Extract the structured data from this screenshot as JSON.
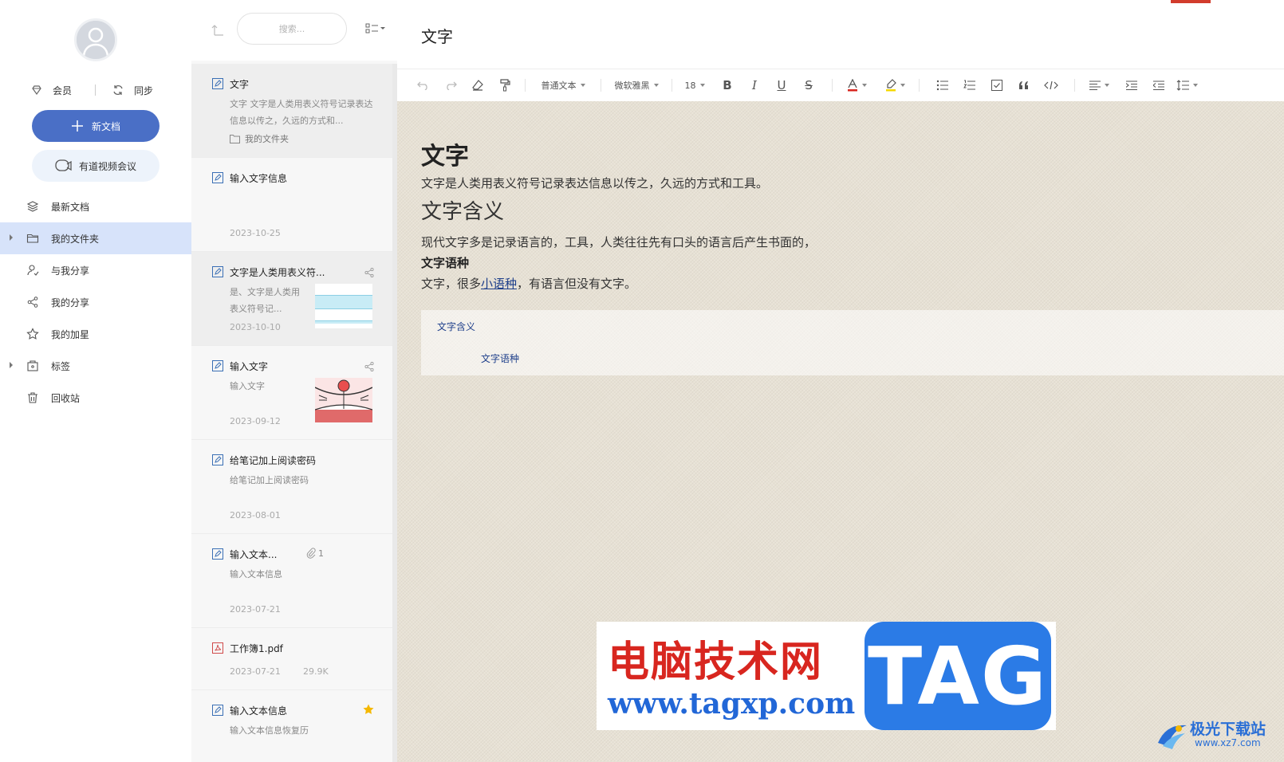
{
  "sidebar": {
    "vip_label": "会员",
    "sync_label": "同步",
    "new_doc_label": "新文档",
    "meeting_label": "有道视频会议",
    "nav": [
      {
        "label": "最新文档",
        "icon": "layers-icon",
        "active": false
      },
      {
        "label": "我的文件夹",
        "icon": "folder-icon",
        "active": true
      },
      {
        "label": "与我分享",
        "icon": "shared-with-me-icon",
        "active": false
      },
      {
        "label": "我的分享",
        "icon": "share-icon",
        "active": false
      },
      {
        "label": "我的加星",
        "icon": "star-icon",
        "active": false
      },
      {
        "label": "标签",
        "icon": "tag-icon",
        "active": false
      },
      {
        "label": "回收站",
        "icon": "trash-icon",
        "active": false
      }
    ]
  },
  "list": {
    "search_placeholder": "搜索...",
    "notes": [
      {
        "title": "文字",
        "summary": "文字 文字是人类用表义符号记录表达信息以传之，久远的方式和...",
        "folder": "我的文件夹",
        "date": ""
      },
      {
        "title": "输入文字信息",
        "summary": "",
        "date": "2023-10-25"
      },
      {
        "title": "文字是人类用表义符...",
        "summary": "是、文字是人类用表义符号记...",
        "date": "2023-10-10"
      },
      {
        "title": "输入文字",
        "summary": "输入文字",
        "date": "2023-09-12"
      },
      {
        "title": "给笔记加上阅读密码",
        "summary": "给笔记加上阅读密码",
        "date": "2023-08-01"
      },
      {
        "title": "输入文本...",
        "summary": "输入文本信息",
        "date": "2023-07-21",
        "attachments": "1"
      },
      {
        "title": "工作簿1.pdf",
        "summary": "",
        "date": "2023-07-21",
        "size": "29.9K"
      },
      {
        "title": "输入文本信息",
        "summary": "输入文本信息恢复历",
        "date": ""
      }
    ]
  },
  "editor": {
    "title": "文字",
    "toolbar": {
      "paragraph_style": "普通文本",
      "font_family": "微软雅黑",
      "font_size": "18"
    },
    "content": {
      "h1": "文字",
      "p1": "文字是人类用表义符号记录表达信息以传之，久远的方式和工具。",
      "h2": "文字含义",
      "p2": "现代文字多是记录语言的，工具，人类往往先有口头的语言后产生书面的，",
      "h3": "文字语种",
      "p3_before": "文字，很多",
      "p3_link": "小语种",
      "p3_after": "，有语言但没有文字。"
    },
    "toc": {
      "item1": "文字含义",
      "item2": "文字语种"
    }
  },
  "watermark": {
    "cn": "电脑技术网",
    "url": "www.tagxp.com",
    "tag": "TAG",
    "site2_cn": "极光下载站",
    "site2_url": "www.xz7.com"
  },
  "colors": {
    "accent": "#4a6fc6",
    "active_nav": "#d7e3fa",
    "link": "#1d3e8a",
    "paper": "#e7e1d4",
    "star": "#f5b800"
  }
}
